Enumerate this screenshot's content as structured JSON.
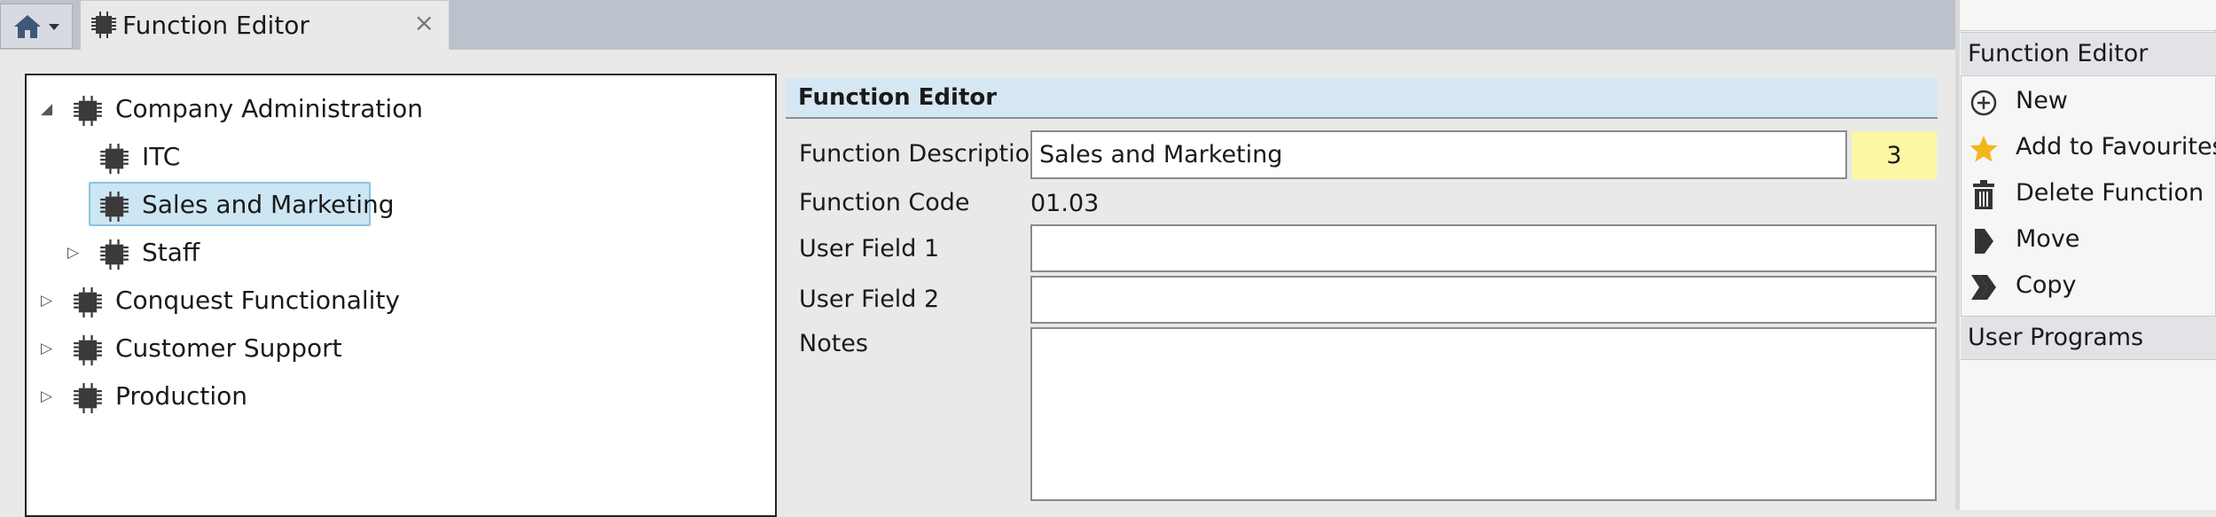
{
  "tab": {
    "title": "Function Editor",
    "close": "×"
  },
  "tree": {
    "nodes": [
      {
        "label": "Company Administration",
        "expander": "◢"
      },
      {
        "label": "ITC"
      },
      {
        "label": "Sales and Marketing"
      },
      {
        "label": "Staff",
        "expander": "▷"
      },
      {
        "label": "Conquest Functionality",
        "expander": "▷"
      },
      {
        "label": "Customer Support",
        "expander": "▷"
      },
      {
        "label": "Production",
        "expander": "▷"
      }
    ]
  },
  "form": {
    "header": "Function Editor",
    "description_label": "Function Description",
    "description_value": "Sales and Marketing",
    "badge": "3",
    "code_label": "Function Code",
    "code_value": "01.03",
    "user1_label": "User Field 1",
    "user1_value": "",
    "user2_label": "User Field 2",
    "user2_value": "",
    "notes_label": "Notes",
    "notes_value": ""
  },
  "actions": {
    "header": "Function Editor",
    "items": [
      {
        "label": "New",
        "icon": "plus-circle-icon"
      },
      {
        "label": "Add to Favourites",
        "icon": "star-icon"
      },
      {
        "label": "Delete Function",
        "icon": "trash-icon"
      },
      {
        "label": "Move",
        "icon": "move-arrow-icon"
      },
      {
        "label": "Copy",
        "icon": "copy-arrows-icon"
      }
    ],
    "footer": "User Programs"
  },
  "colors": {
    "selection": "#cde6f3",
    "header": "#d5e7f2",
    "badge": "#fbf7a3",
    "star": "#f2b61c"
  }
}
